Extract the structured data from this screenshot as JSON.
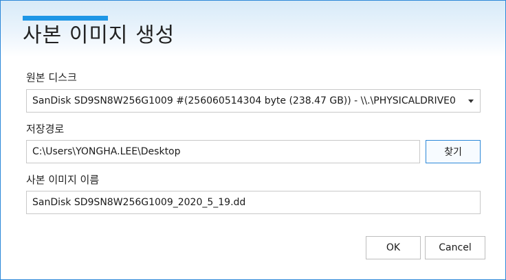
{
  "dialog": {
    "title": "사본 이미지 생성"
  },
  "source_disk": {
    "label": "원본 디스크",
    "selected": "SanDisk SD9SN8W256G1009 #(256060514304 byte (238.47 GB)) - \\\\.\\PHYSICALDRIVE0"
  },
  "save_path": {
    "label": "저장경로",
    "value": "C:\\Users\\YONGHA.LEE\\Desktop",
    "browse_label": "찾기"
  },
  "image_name": {
    "label": "사본 이미지 이름",
    "value": "SanDisk SD9SN8W256G1009_2020_5_19.dd"
  },
  "buttons": {
    "ok_label": "OK",
    "cancel_label": "Cancel"
  },
  "colors": {
    "accent": "#1e96e6",
    "window_border": "#2b87d8",
    "header_gradient_top": "#d7eaf8"
  }
}
